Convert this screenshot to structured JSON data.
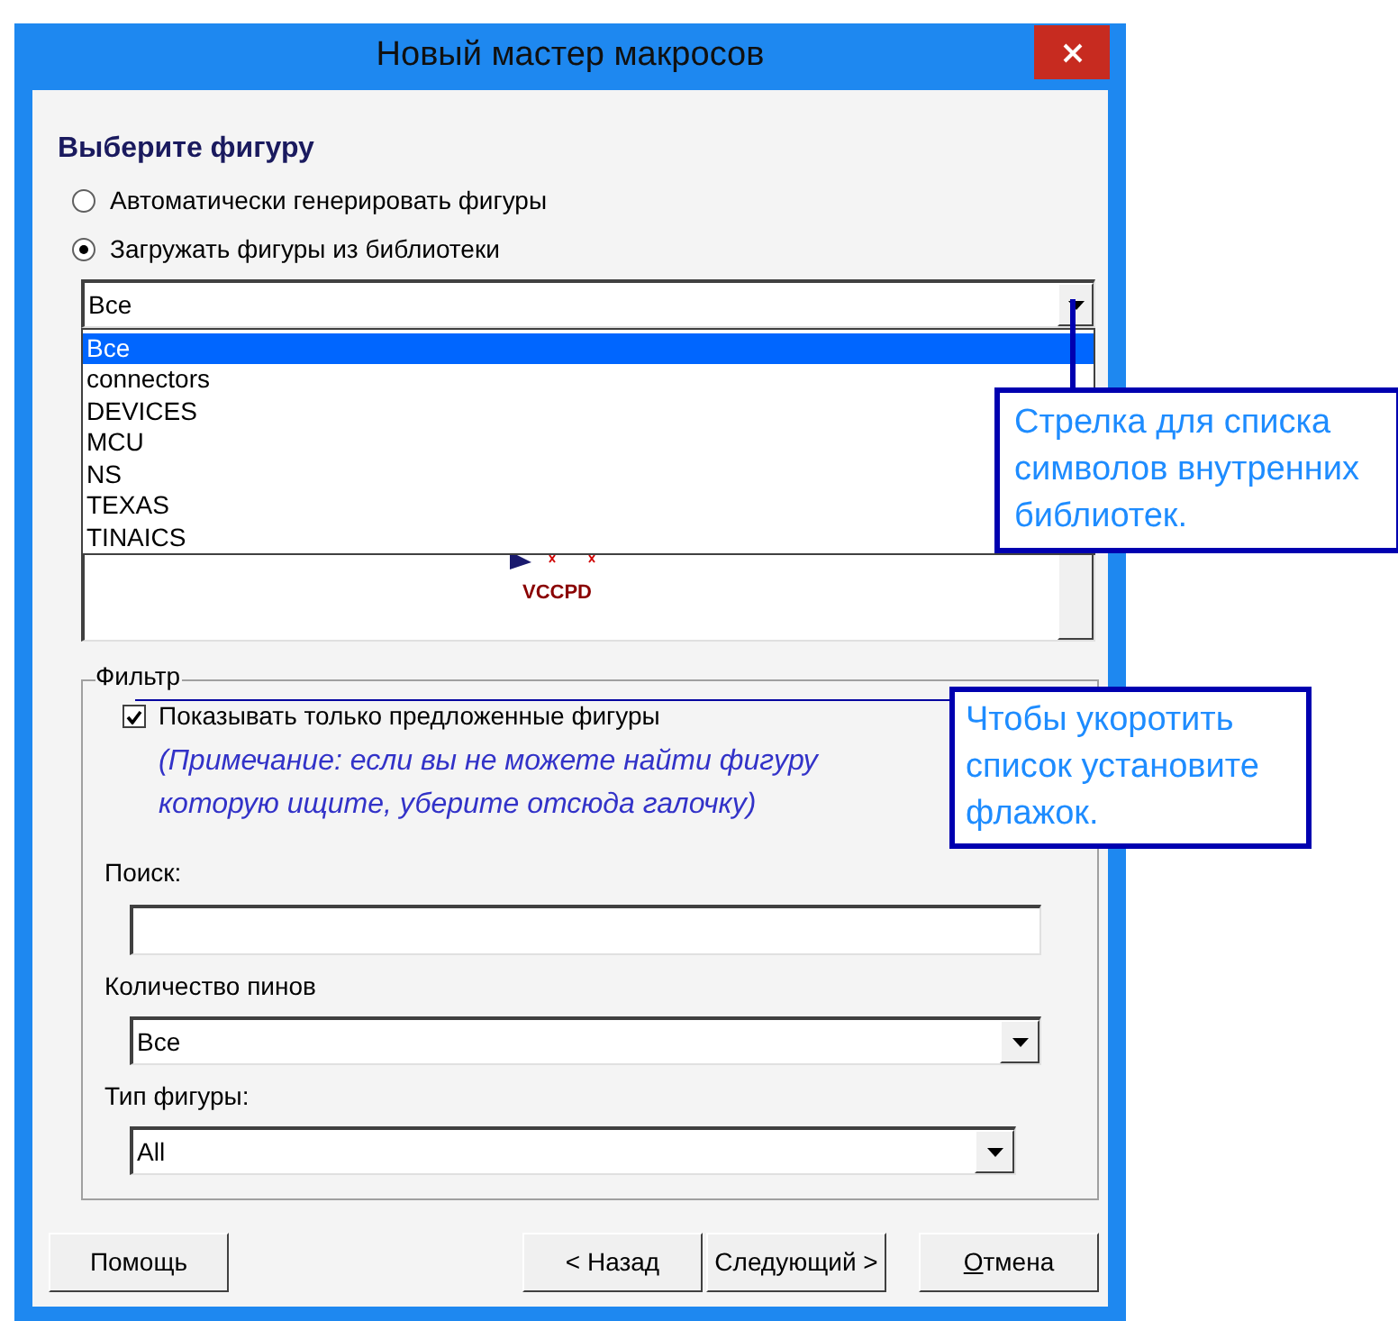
{
  "window": {
    "title": "Новый мастер макросов"
  },
  "heading": "Выберите фигуру",
  "source_options": [
    {
      "label": "Автоматически генерировать фигуры",
      "selected": false
    },
    {
      "label": "Загружать фигуры из библиотеки",
      "selected": true
    }
  ],
  "library_combo": {
    "value": "Все"
  },
  "library_list": [
    {
      "label": "Все",
      "selected": true
    },
    {
      "label": "connectors",
      "selected": false
    },
    {
      "label": "DEVICES",
      "selected": false
    },
    {
      "label": "MCU",
      "selected": false
    },
    {
      "label": "NS",
      "selected": false
    },
    {
      "label": "TEXAS",
      "selected": false
    },
    {
      "label": "TINAICS",
      "selected": false
    }
  ],
  "preview": {
    "pin_label": "VCCPD"
  },
  "filter": {
    "title": "Фильтр",
    "checkbox": {
      "label": "Показывать только предложенные фигуры",
      "checked": true
    },
    "note": "(Примечание: если вы не можете найти фигуру которую ищите, уберите отсюда галочку)",
    "search": {
      "label": "Поиск:"
    },
    "pin_count": {
      "label": "Количество пинов",
      "value": "Все"
    },
    "shape_type": {
      "label": "Тип фигуры:",
      "value": "All"
    }
  },
  "buttons": [
    {
      "label": "Помощь"
    },
    {
      "label": "< Назад"
    },
    {
      "label": "Следующий >"
    },
    {
      "label": "Отмена",
      "underline_first": true
    }
  ],
  "callouts": [
    {
      "text": "Стрелка для списка\nсимволов внутренних\nбиблиотек."
    },
    {
      "text": "Чтобы укоротить\nсписок установите\nфлажок."
    }
  ]
}
